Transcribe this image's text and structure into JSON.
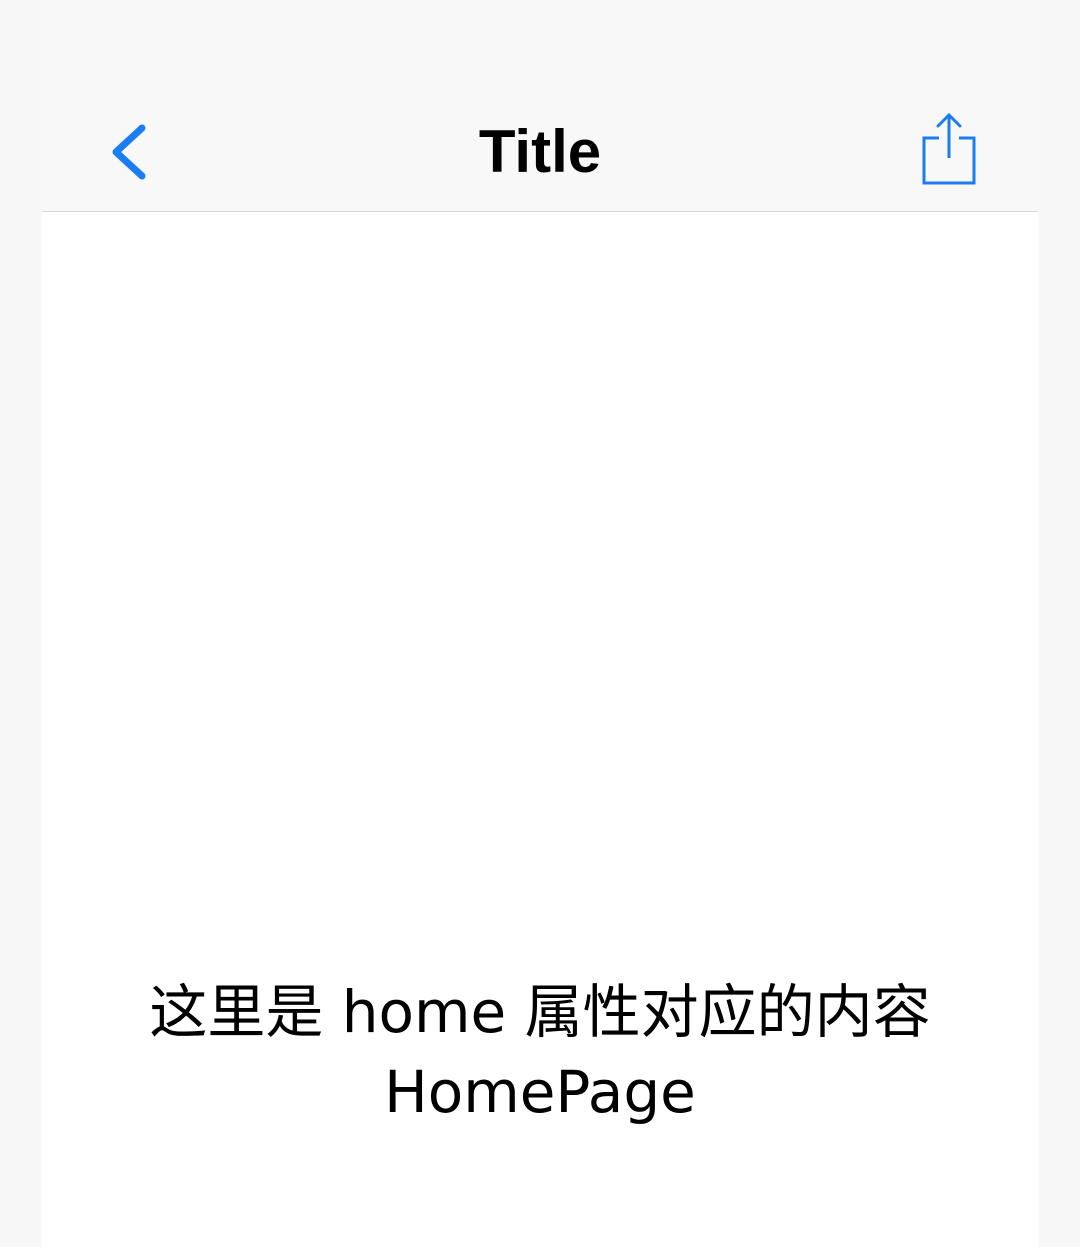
{
  "navbar": {
    "title": "Title",
    "back_icon": "chevron-left-icon",
    "share_icon": "share-icon",
    "accent_color": "#1a7df2"
  },
  "main": {
    "line1": "这里是 home 属性对应的内容",
    "line2": "HomePage"
  }
}
